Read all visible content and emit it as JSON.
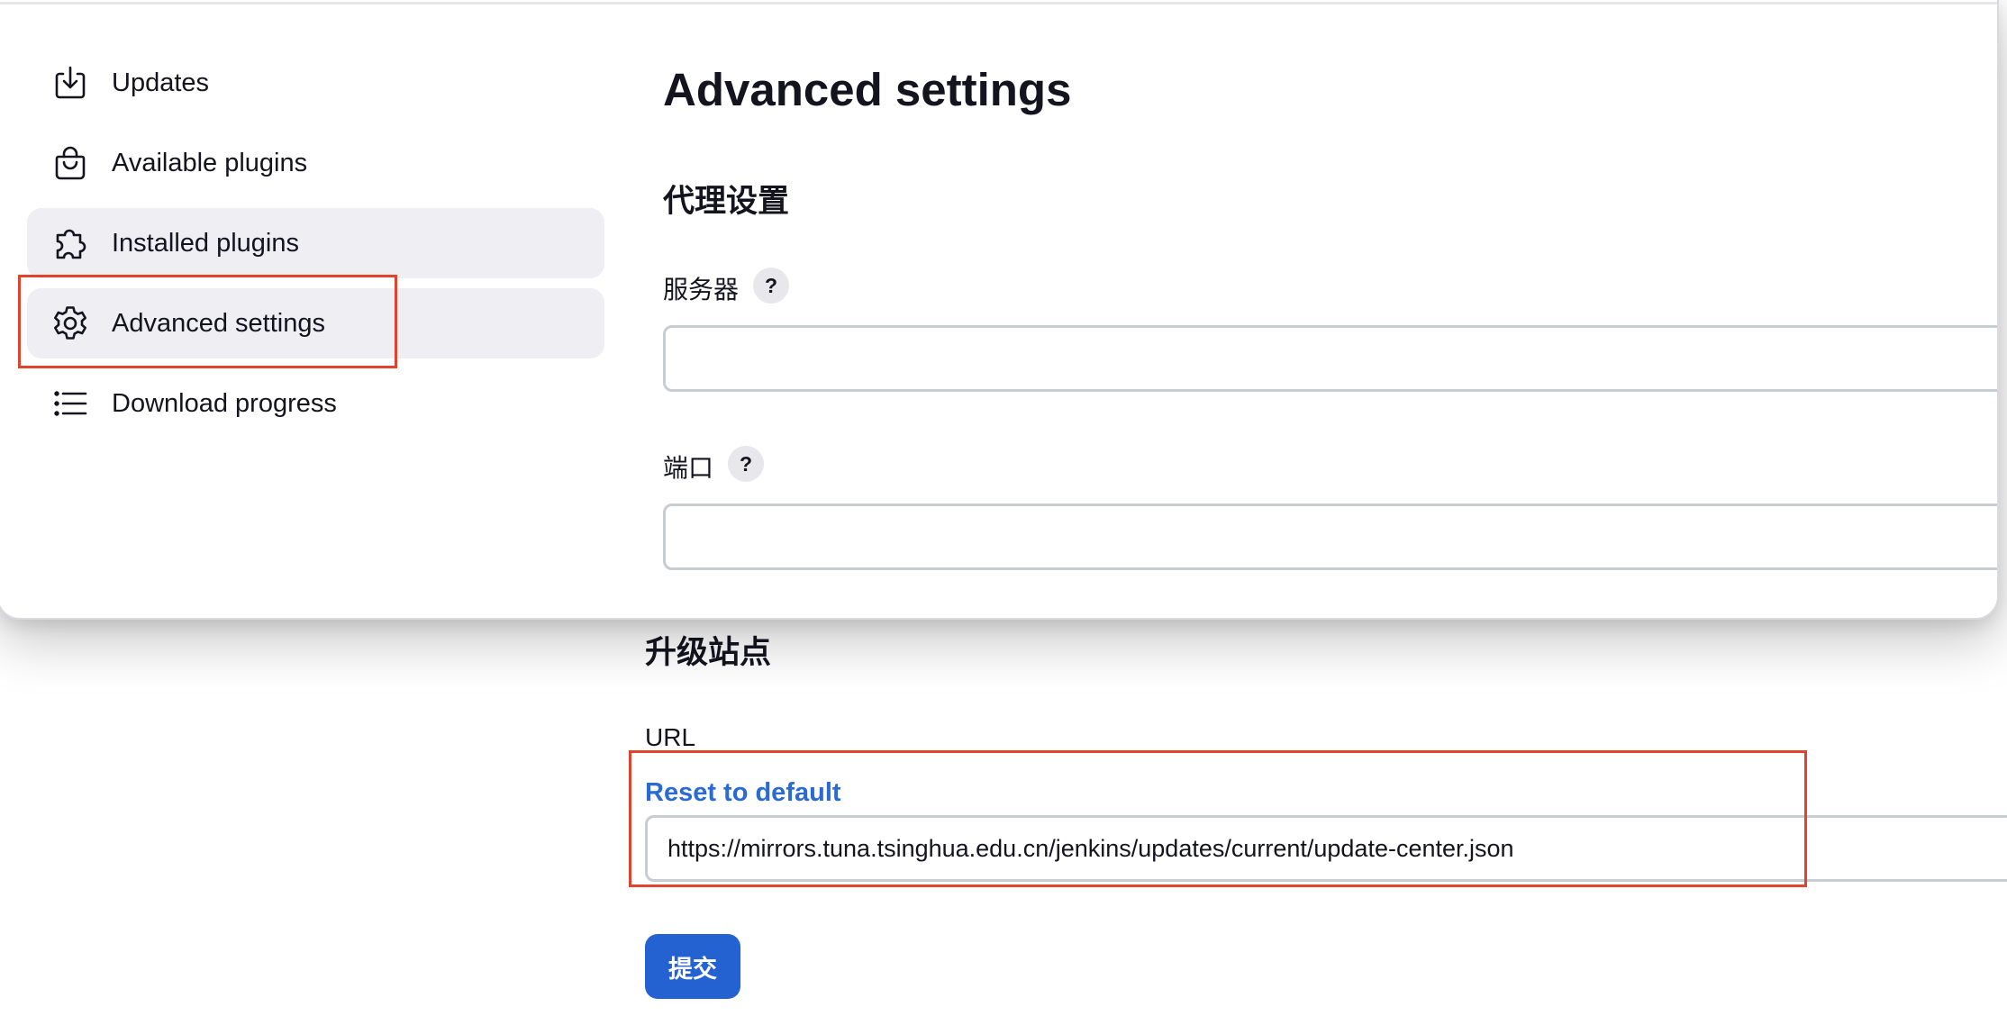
{
  "sidebar": {
    "items": [
      {
        "label": "Updates",
        "icon": "download-icon",
        "active": false
      },
      {
        "label": "Available plugins",
        "icon": "shopping-bag-icon",
        "active": false
      },
      {
        "label": "Installed plugins",
        "icon": "puzzle-icon",
        "active": true
      },
      {
        "label": "Advanced settings",
        "icon": "gear-icon",
        "active": true
      },
      {
        "label": "Download progress",
        "icon": "list-icon",
        "active": false
      }
    ]
  },
  "main": {
    "title": "Advanced settings",
    "proxy": {
      "section_title": "代理设置",
      "server_label": "服务器",
      "server_value": "",
      "port_label": "端口",
      "port_value": "",
      "help_symbol": "?"
    },
    "update_site": {
      "section_title": "升级站点",
      "url_label": "URL",
      "reset_link": "Reset to default",
      "url_value": "https://mirrors.tuna.tsinghua.edu.cn/jenkins/updates/current/update-center.json"
    },
    "submit_label": "提交"
  },
  "colors": {
    "accent": "#2462d2",
    "link": "#2a6ad3",
    "annotation_red": "#e0442f",
    "active_item_bg": "#eeeef3"
  }
}
